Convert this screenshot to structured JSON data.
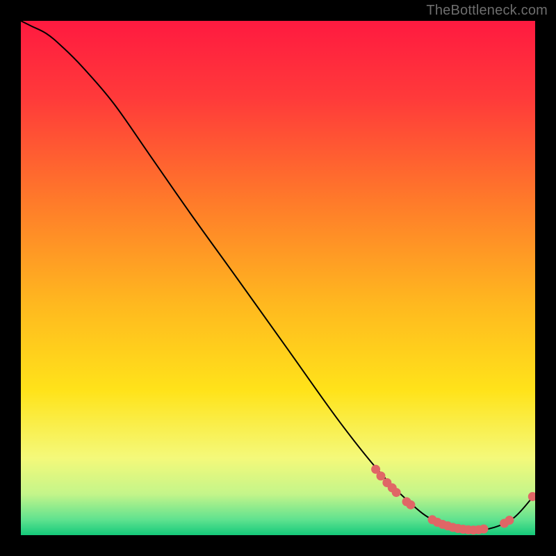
{
  "watermark": "TheBottleneck.com",
  "chart_data": {
    "type": "line",
    "title": "",
    "xlabel": "",
    "ylabel": "",
    "xlim": [
      0,
      100
    ],
    "ylim": [
      0,
      100
    ],
    "grid": false,
    "legend": false,
    "series": [
      {
        "name": "curve",
        "color": "#000000",
        "x": [
          0,
          2,
          5,
          8,
          12,
          18,
          25,
          33,
          42,
          52,
          62,
          70,
          76,
          80,
          84,
          88,
          92,
          96,
          100
        ],
        "y": [
          100,
          99,
          97.5,
          95,
          91,
          84,
          74,
          62.5,
          50,
          36,
          22,
          12,
          6,
          3,
          1.5,
          1,
          1.5,
          3.5,
          8
        ]
      }
    ],
    "markers": {
      "color": "#e06666",
      "points": [
        {
          "x": 69.0,
          "y": 12.8
        },
        {
          "x": 70.0,
          "y": 11.5
        },
        {
          "x": 71.2,
          "y": 10.2
        },
        {
          "x": 72.2,
          "y": 9.2
        },
        {
          "x": 73.0,
          "y": 8.3
        },
        {
          "x": 75.0,
          "y": 6.5
        },
        {
          "x": 75.8,
          "y": 5.9
        },
        {
          "x": 80.0,
          "y": 3.0
        },
        {
          "x": 81.0,
          "y": 2.5
        },
        {
          "x": 82.0,
          "y": 2.1
        },
        {
          "x": 83.0,
          "y": 1.8
        },
        {
          "x": 84.0,
          "y": 1.5
        },
        {
          "x": 85.0,
          "y": 1.3
        },
        {
          "x": 86.0,
          "y": 1.15
        },
        {
          "x": 87.0,
          "y": 1.05
        },
        {
          "x": 88.0,
          "y": 1.0
        },
        {
          "x": 89.0,
          "y": 1.05
        },
        {
          "x": 90.0,
          "y": 1.2
        },
        {
          "x": 94.0,
          "y": 2.3
        },
        {
          "x": 95.0,
          "y": 2.9
        },
        {
          "x": 99.5,
          "y": 7.5
        }
      ]
    },
    "background_gradient": {
      "stops": [
        {
          "offset": 0.0,
          "color": "#ff1a40"
        },
        {
          "offset": 0.15,
          "color": "#ff3a3a"
        },
        {
          "offset": 0.35,
          "color": "#ff7a2a"
        },
        {
          "offset": 0.55,
          "color": "#ffb81f"
        },
        {
          "offset": 0.72,
          "color": "#ffe31a"
        },
        {
          "offset": 0.85,
          "color": "#f4f97a"
        },
        {
          "offset": 0.92,
          "color": "#c4f58a"
        },
        {
          "offset": 0.97,
          "color": "#5fe28f"
        },
        {
          "offset": 1.0,
          "color": "#14c97a"
        }
      ]
    }
  }
}
